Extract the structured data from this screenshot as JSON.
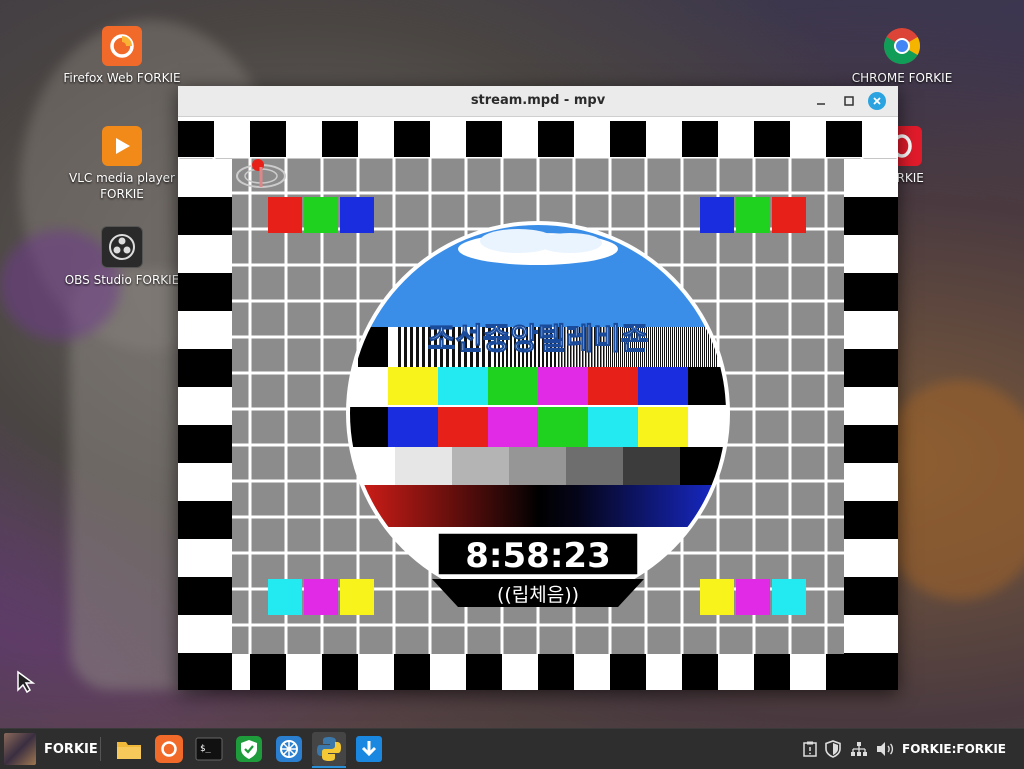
{
  "desktop": {
    "icons": [
      {
        "label": "Firefox Web FORKIE",
        "icon": "firefox-icon",
        "color": "#f26a2a"
      },
      {
        "label": "VLC media player FORKIE",
        "icon": "vlc-icon",
        "color": "#f28a1a"
      },
      {
        "label": "OBS Studio FORKIE",
        "icon": "obs-icon",
        "color": "#2a2a2a"
      },
      {
        "label": "CHROME FORKIE",
        "icon": "chrome-icon",
        "color": "#4285f4"
      },
      {
        "label": "FORKIE",
        "icon": "opera-icon",
        "color": "#e21b2b"
      }
    ]
  },
  "window": {
    "title": "stream.mpd - mpv",
    "minimize_icon": "minimize-icon",
    "maximize_icon": "maximize-icon",
    "close_icon": "close-icon"
  },
  "test_card": {
    "channel_name": "조선중앙텔레비죤",
    "time": "8:58:23",
    "caption": "((립체음))",
    "colors": {
      "red": "#e8201a",
      "green": "#1fd21f",
      "blue": "#1a2ee0",
      "yellow": "#f8f31a",
      "cyan": "#22eaf0",
      "magenta": "#e02ae6",
      "grid_gray": "#8c8c8c",
      "sky_blue": "#3a8ee8"
    }
  },
  "taskbar": {
    "start_label": "FORKIE",
    "apps": [
      {
        "name": "file-manager-icon",
        "active": false
      },
      {
        "name": "firefox-icon",
        "active": false
      },
      {
        "name": "terminal-icon",
        "active": false
      },
      {
        "name": "shield-app-icon",
        "active": false
      },
      {
        "name": "network-app-icon",
        "active": false
      },
      {
        "name": "python-icon",
        "active": true
      },
      {
        "name": "download-icon",
        "active": false
      }
    ],
    "tray_icons": [
      "clipboard-icon",
      "shield-tray-icon",
      "network-tray-icon",
      "volume-icon"
    ],
    "clock_label": "FORKIE:FORKIE",
    "accent": "#2a8fd6"
  }
}
